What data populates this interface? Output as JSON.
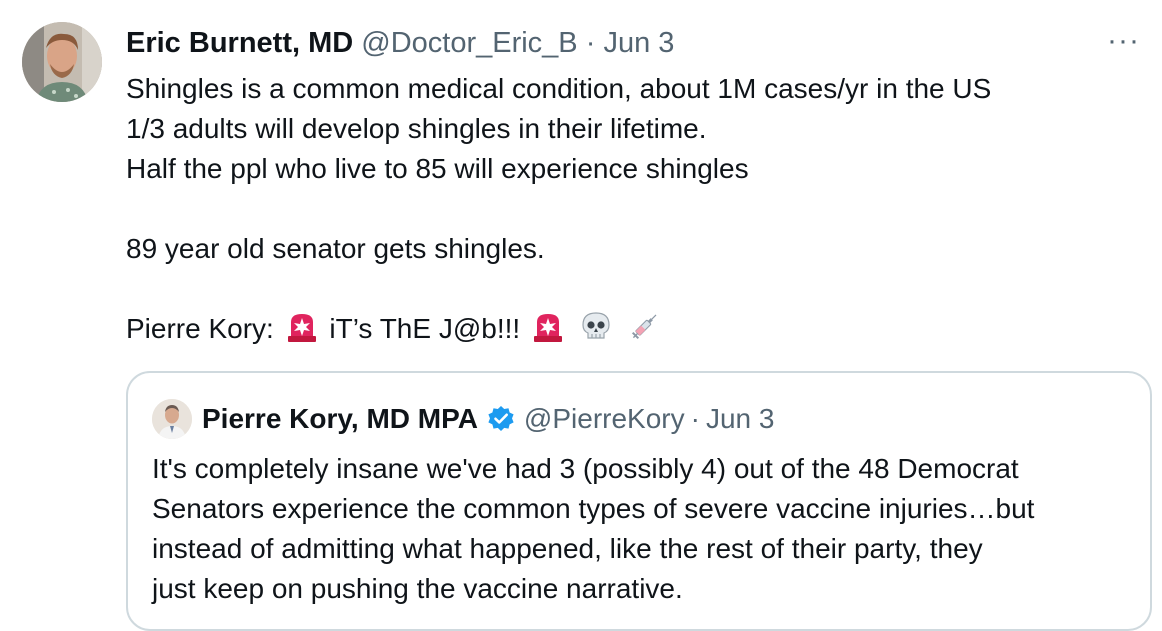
{
  "tweet": {
    "author_name": "Eric Burnett, MD",
    "handle": "@Doctor_Eric_B",
    "separator": "·",
    "date": "Jun 3",
    "more_label": "···",
    "lines": [
      "Shingles is a common medical condition, about 1M cases/yr in the US",
      "1/3 adults will develop shingles in their lifetime.",
      "Half the ppl who live to 85 will experience shingles",
      "89 year old senator gets shingles."
    ],
    "last_line_prefix": "Pierre Kory:",
    "last_line_middle": "iT’s ThE J@b!!!",
    "emoji_icons": [
      "siren-icon",
      "siren-icon",
      "skull-icon",
      "syringe-icon"
    ]
  },
  "quote": {
    "author_name": "Pierre Kory, MD MPA",
    "handle": "@PierreKory",
    "separator": "·",
    "date": "Jun 3",
    "verified_icon": "verified-badge-icon",
    "verified_color": "#1d9bf0",
    "lines": [
      "It's completely insane we've had 3 (possibly 4) out of the 48 Democrat",
      "Senators experience the common types of severe vaccine injuries…but",
      "instead of admitting what happened, like the rest of their party, they",
      "just keep on pushing the vaccine narrative."
    ]
  },
  "colors": {
    "text": "#0f1419",
    "muted": "#536471",
    "border": "#cfd9de",
    "siren": "#e0245e"
  }
}
